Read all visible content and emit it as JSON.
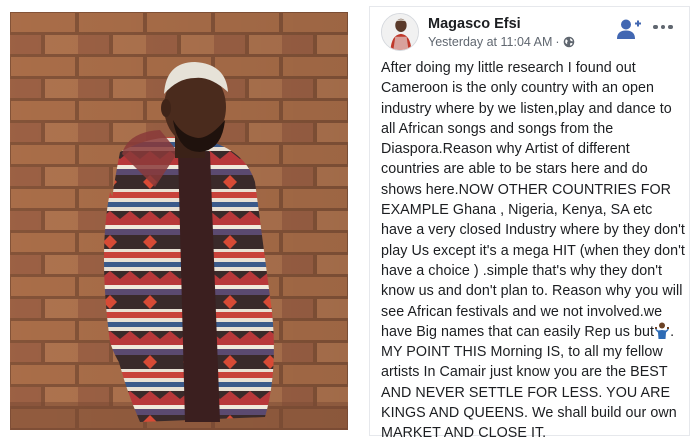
{
  "post": {
    "author": "Magasco Efsi",
    "timestamp": "Yesterday at 11:04 AM",
    "separator": "·",
    "privacy_icon": "globe-icon",
    "actions": {
      "follow_icon": "add-friend-icon",
      "more_icon": "more-options-icon"
    },
    "text_part1": "After doing my little research I found out Cameroon is the only country with an open industry where by we listen,play  and dance to all African songs and songs from the Diaspora.Reason why Artist of different countries are able to be stars here and do shows here.NOW OTHER COUNTRIES FOR EXAMPLE Ghana , Nigeria, Kenya, SA etc have a very closed Industry where by they don't play Us except it's a mega HIT (when they don't have a choice ) .simple that's why they don't know us and don't plan to. Reason why you will see African festivals and we not involved.we have Big names that can easily Rep us but",
    "text_emoji": "person-shrugging-emoji",
    "text_part2": ". MY POINT THIS Morning IS, to all my fellow artists In Camair just know you are the BEST AND NEVER SETTLE FOR LESS. YOU ARE KINGS AND QUEENS. We shall build our own MARKET AND CLOSE IT."
  },
  "colors": {
    "facebook_blue": "#4267b2",
    "text_primary": "#1c1e21",
    "text_secondary": "#606770",
    "brick": "#b06f4b"
  }
}
